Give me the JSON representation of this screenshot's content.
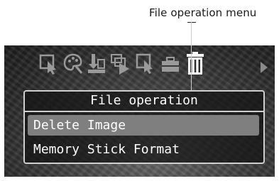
{
  "callout": {
    "label": "File operation menu"
  },
  "toolbar": {
    "icons": [
      "select-icon",
      "palette-icon",
      "import-icon",
      "slideshow-icon",
      "zoom-select-icon",
      "briefcase-icon",
      "trash-icon",
      "next-arrow-icon"
    ],
    "selected": "trash-icon"
  },
  "menu": {
    "title": "File operation",
    "items": [
      {
        "label": "Delete Image",
        "selected": true
      },
      {
        "label": "Memory Stick Format",
        "selected": false
      }
    ]
  }
}
